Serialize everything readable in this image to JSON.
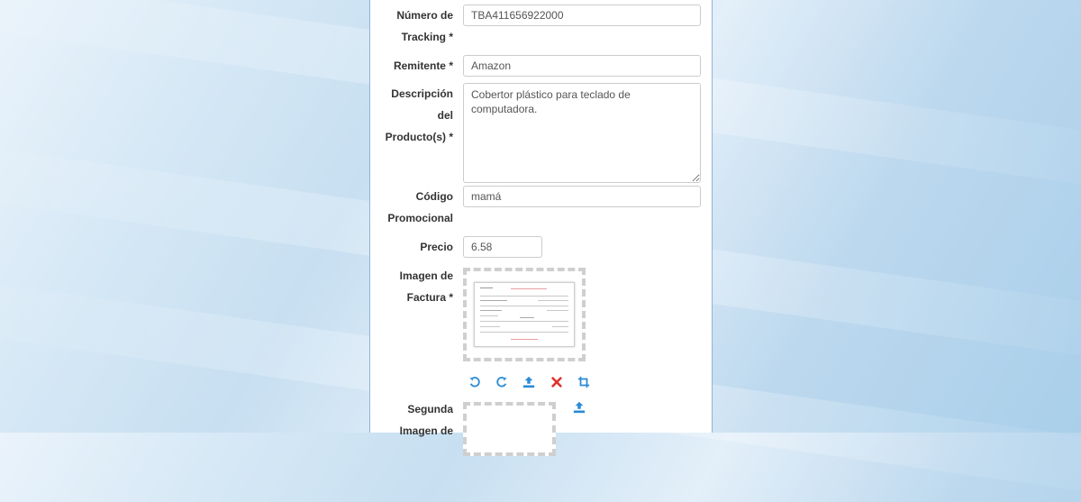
{
  "form": {
    "tracking": {
      "label_line1": "Número de",
      "label_line2": "Tracking *",
      "value": "TBA411656922000"
    },
    "remitente": {
      "label": "Remitente *",
      "value": "Amazon"
    },
    "descripcion": {
      "label_line1": "Descripción",
      "label_line2": "del",
      "label_line3": "Producto(s) *",
      "value": "Cobertor plástico para teclado de computadora."
    },
    "codigo": {
      "label_line1": "Código",
      "label_line2": "Promocional",
      "value": "mamá"
    },
    "precio": {
      "label": "Precio",
      "value": "6.58"
    },
    "imagen_factura": {
      "label_line1": "Imagen de",
      "label_line2": "Factura *"
    },
    "segunda_imagen": {
      "label_line1": "Segunda",
      "label_line2": "Imagen de"
    }
  },
  "toolbar": {
    "icons": [
      "rotate-left-icon",
      "rotate-right-icon",
      "upload-icon",
      "delete-icon",
      "crop-icon"
    ]
  },
  "colors": {
    "accent": "#2a8bd6",
    "danger": "#e0302e",
    "label": "#333333"
  }
}
